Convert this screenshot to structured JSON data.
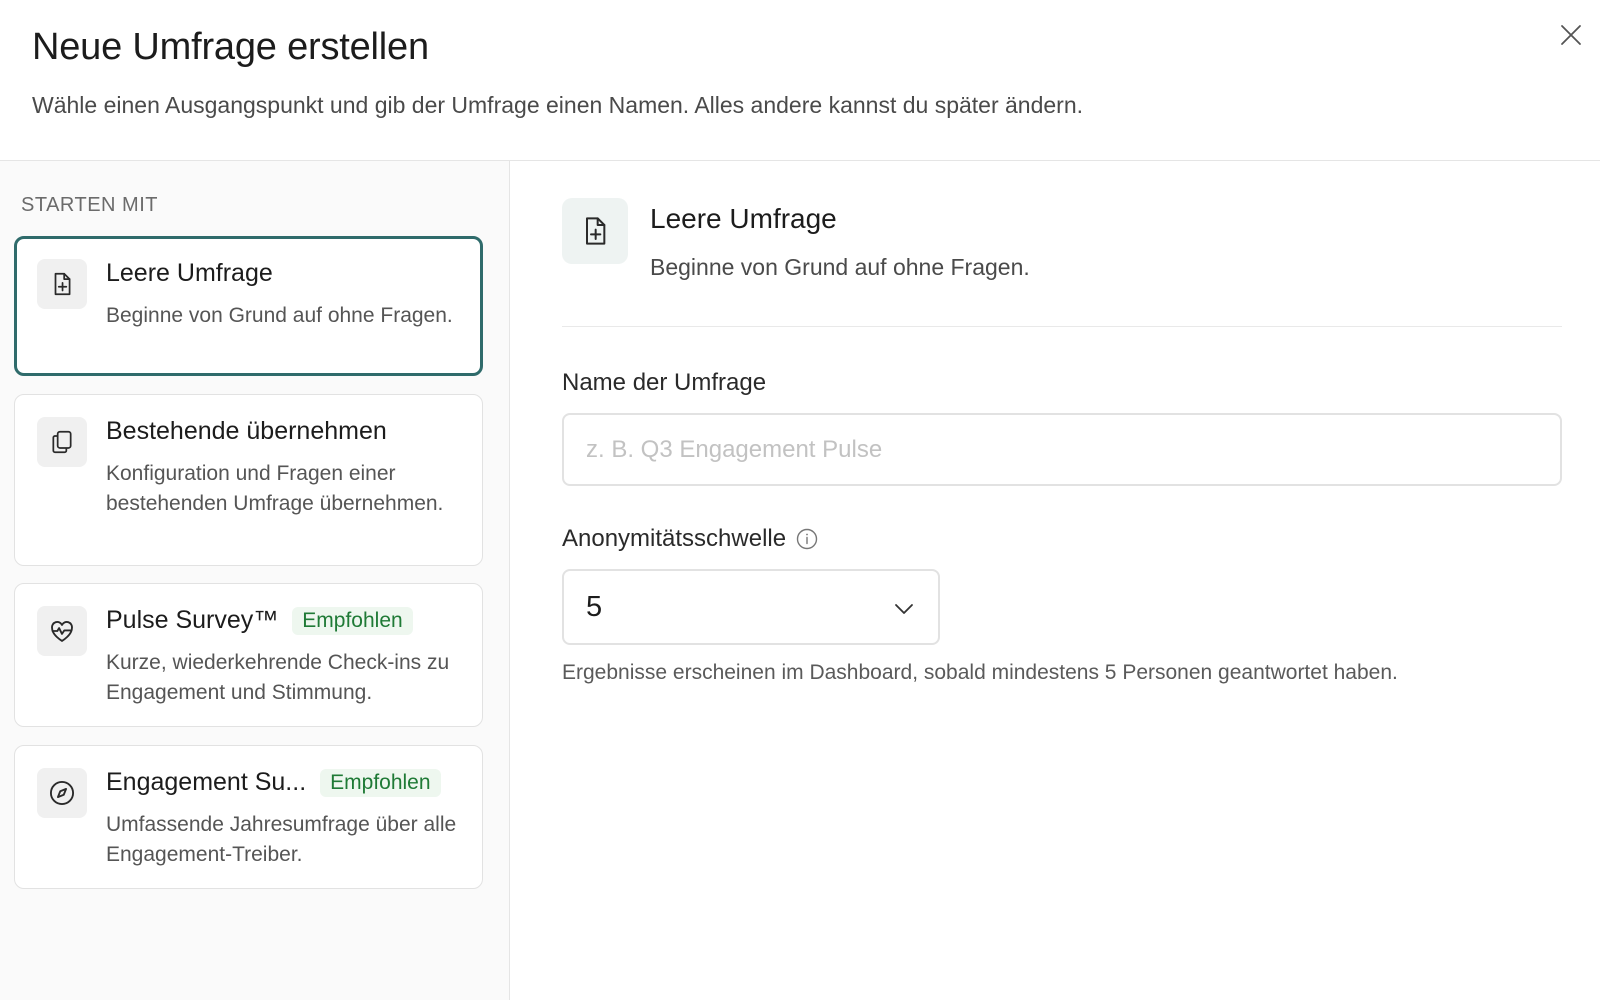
{
  "header": {
    "title": "Neue Umfrage erstellen",
    "subtitle": "Wähle einen Ausgangspunkt und gib der Umfrage einen Namen. Alles andere kannst du später ändern.",
    "close_icon": "close-icon"
  },
  "sidebar": {
    "section_label": "STARTEN MIT",
    "options": [
      {
        "title": "Leere Umfrage",
        "description": "Beginne von Grund auf ohne Fragen.",
        "icon": "file-plus-icon",
        "selected": true
      },
      {
        "title": "Bestehende übernehmen",
        "description": "Konfiguration und Fragen einer bestehenden Umfrage übernehmen.",
        "icon": "copy-icon",
        "selected": false
      },
      {
        "title": "Pulse Survey™",
        "badge": "Empfohlen",
        "description": "Kurze, wiederkehrende Check-ins zu Engagement und Stimmung.",
        "icon": "heart-pulse-icon",
        "selected": false
      },
      {
        "title": "Engagement Su...",
        "badge": "Empfohlen",
        "description": "Umfassende Jahresumfrage über alle Engagement-Treiber.",
        "icon": "compass-icon",
        "selected": false
      }
    ]
  },
  "preview": {
    "title": "Leere Umfrage",
    "description": "Beginne von Grund auf ohne Fragen.",
    "icon": "file-plus-icon"
  },
  "form": {
    "name_label": "Name der Umfrage",
    "name_value": "",
    "name_placeholder": "z. B. Q3 Engagement Pulse",
    "threshold_label": "Anonymitätsschwelle",
    "threshold_value": "5",
    "threshold_helper": "Ergebnisse erscheinen im Dashboard, sobald mindestens 5 Personen geantwortet haben."
  },
  "colors": {
    "accent": "#2f6b6b",
    "badge_text": "#1f7a36",
    "badge_bg": "#eef7ef"
  }
}
